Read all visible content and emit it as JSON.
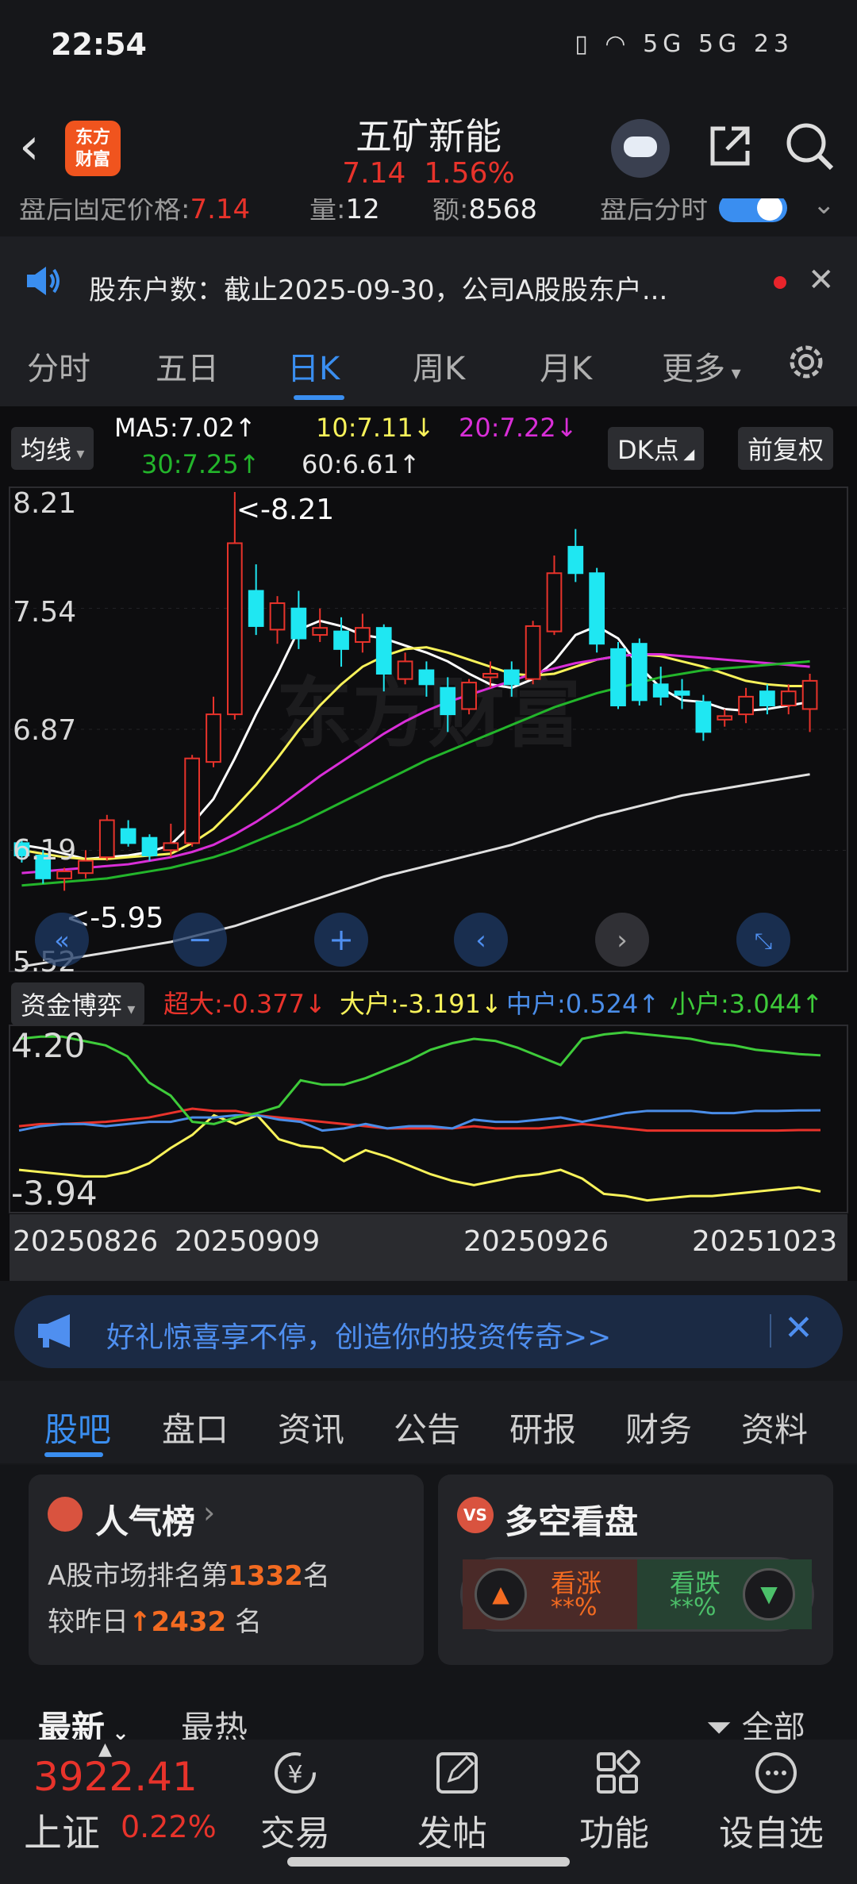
{
  "status": {
    "time": "22:54",
    "icons_text": "5G 5G 23"
  },
  "header": {
    "logo_text": "东方\n财富",
    "stock_name": "五矿新能",
    "price": "7.14",
    "change_pct": "1.56%"
  },
  "afterhours": {
    "fixed_label": "盘后固定价格:",
    "fixed_value": "7.14",
    "vol_label": "量:",
    "vol_value": "12",
    "amt_label": "额:",
    "amt_value": "8568",
    "timeshare_label": "盘后分时"
  },
  "notice": {
    "text": "股东户数：截止2025-09-30，公司A股股东户..."
  },
  "period_tabs": [
    "分时",
    "五日",
    "日K",
    "周K",
    "月K",
    "更多"
  ],
  "ma": {
    "selector": "均线",
    "ma5": "MA5:7.02↑",
    "ma10": "10:7.11↓",
    "ma20": "20:7.22↓",
    "ma30": "30:7.25↑",
    "ma60": "60:6.61↑",
    "dk": "DK点",
    "adjust": "前复权"
  },
  "colors": {
    "up": "#e8332b",
    "down": "#1fe7f2",
    "ma5": "#ffffff",
    "ma10": "#f8f25a",
    "ma20": "#d92ed8",
    "ma30": "#23b52b",
    "ma60": "#e0e0e0",
    "accent": "#3a8ef0"
  },
  "chart_data": [
    {
      "type": "candlestick",
      "y_ticks": [
        "8.21",
        "7.54",
        "6.87",
        "6.19",
        "5.52"
      ],
      "ylim": [
        5.52,
        8.21
      ],
      "annotations": {
        "high": "<-8.21",
        "low": "<-5.95"
      },
      "candles": [
        {
          "o": 6.22,
          "c": 6.15,
          "h": 6.24,
          "l": 6.11
        },
        {
          "o": 6.15,
          "c": 6.02,
          "h": 6.18,
          "l": 5.99
        },
        {
          "o": 6.02,
          "c": 6.06,
          "h": 6.08,
          "l": 5.95
        },
        {
          "o": 6.05,
          "c": 6.12,
          "h": 6.18,
          "l": 6.02
        },
        {
          "o": 6.14,
          "c": 6.35,
          "h": 6.38,
          "l": 6.12
        },
        {
          "o": 6.3,
          "c": 6.22,
          "h": 6.35,
          "l": 6.2
        },
        {
          "o": 6.25,
          "c": 6.15,
          "h": 6.27,
          "l": 6.12
        },
        {
          "o": 6.18,
          "c": 6.22,
          "h": 6.33,
          "l": 6.14
        },
        {
          "o": 6.22,
          "c": 6.7,
          "h": 6.72,
          "l": 6.2
        },
        {
          "o": 6.68,
          "c": 6.95,
          "h": 7.05,
          "l": 6.65
        },
        {
          "o": 6.95,
          "c": 7.92,
          "h": 8.21,
          "l": 6.92
        },
        {
          "o": 7.65,
          "c": 7.45,
          "h": 7.8,
          "l": 7.4
        },
        {
          "o": 7.43,
          "c": 7.58,
          "h": 7.62,
          "l": 7.35
        },
        {
          "o": 7.55,
          "c": 7.38,
          "h": 7.65,
          "l": 7.32
        },
        {
          "o": 7.4,
          "c": 7.44,
          "h": 7.55,
          "l": 7.36
        },
        {
          "o": 7.42,
          "c": 7.32,
          "h": 7.5,
          "l": 7.22
        },
        {
          "o": 7.36,
          "c": 7.44,
          "h": 7.52,
          "l": 7.3
        },
        {
          "o": 7.44,
          "c": 7.18,
          "h": 7.46,
          "l": 7.08
        },
        {
          "o": 7.15,
          "c": 7.25,
          "h": 7.3,
          "l": 7.12
        },
        {
          "o": 7.2,
          "c": 7.12,
          "h": 7.25,
          "l": 7.05
        },
        {
          "o": 7.1,
          "c": 6.95,
          "h": 7.16,
          "l": 6.85
        },
        {
          "o": 6.98,
          "c": 7.13,
          "h": 7.15,
          "l": 6.95
        },
        {
          "o": 7.16,
          "c": 7.18,
          "h": 7.25,
          "l": 7.1
        },
        {
          "o": 7.2,
          "c": 7.12,
          "h": 7.25,
          "l": 7.05
        },
        {
          "o": 7.15,
          "c": 7.45,
          "h": 7.48,
          "l": 7.12
        },
        {
          "o": 7.42,
          "c": 7.75,
          "h": 7.85,
          "l": 7.4
        },
        {
          "o": 7.9,
          "c": 7.75,
          "h": 8.0,
          "l": 7.7
        },
        {
          "o": 7.75,
          "c": 7.35,
          "h": 7.78,
          "l": 7.3
        },
        {
          "o": 7.32,
          "c": 7.0,
          "h": 7.36,
          "l": 6.98
        },
        {
          "o": 7.35,
          "c": 7.03,
          "h": 7.38,
          "l": 7.0
        },
        {
          "o": 7.12,
          "c": 7.05,
          "h": 7.22,
          "l": 7.0
        },
        {
          "o": 7.08,
          "c": 7.06,
          "h": 7.15,
          "l": 6.98
        },
        {
          "o": 7.02,
          "c": 6.85,
          "h": 7.06,
          "l": 6.8
        },
        {
          "o": 6.92,
          "c": 6.94,
          "h": 6.98,
          "l": 6.88
        },
        {
          "o": 6.95,
          "c": 7.05,
          "h": 7.1,
          "l": 6.9
        },
        {
          "o": 7.08,
          "c": 7.0,
          "h": 7.12,
          "l": 6.95
        },
        {
          "o": 7.0,
          "c": 7.08,
          "h": 7.12,
          "l": 6.95
        },
        {
          "o": 6.98,
          "c": 7.14,
          "h": 7.18,
          "l": 6.85
        }
      ],
      "ma_series": [
        {
          "name": "MA5",
          "values": [
            6.21,
            6.19,
            6.16,
            6.13,
            6.14,
            6.15,
            6.17,
            6.21,
            6.33,
            6.47,
            6.7,
            6.95,
            7.18,
            7.43,
            7.48,
            7.45,
            7.4,
            7.38,
            7.34,
            7.3,
            7.25,
            7.18,
            7.12,
            7.1,
            7.15,
            7.25,
            7.4,
            7.45,
            7.38,
            7.22,
            7.1,
            7.03,
            7.02,
            6.98,
            6.97,
            6.98,
            7.0,
            7.02
          ]
        },
        {
          "name": "10",
          "values": [
            6.18,
            6.16,
            6.14,
            6.13,
            6.13,
            6.14,
            6.15,
            6.16,
            6.22,
            6.3,
            6.42,
            6.55,
            6.7,
            6.86,
            7.0,
            7.12,
            7.22,
            7.28,
            7.32,
            7.33,
            7.3,
            7.26,
            7.22,
            7.18,
            7.17,
            7.18,
            7.22,
            7.26,
            7.28,
            7.29,
            7.28,
            7.25,
            7.22,
            7.18,
            7.14,
            7.12,
            7.11,
            7.11
          ]
        },
        {
          "name": "20",
          "values": [
            6.05,
            6.06,
            6.07,
            6.08,
            6.09,
            6.1,
            6.12,
            6.14,
            6.17,
            6.21,
            6.27,
            6.34,
            6.42,
            6.51,
            6.6,
            6.68,
            6.76,
            6.84,
            6.91,
            6.97,
            7.02,
            7.06,
            7.1,
            7.14,
            7.18,
            7.21,
            7.24,
            7.26,
            7.28,
            7.29,
            7.29,
            7.28,
            7.27,
            7.26,
            7.25,
            7.24,
            7.23,
            7.22
          ]
        },
        {
          "name": "30",
          "values": [
            5.98,
            5.99,
            6.0,
            6.01,
            6.02,
            6.04,
            6.06,
            6.08,
            6.11,
            6.14,
            6.18,
            6.23,
            6.28,
            6.33,
            6.39,
            6.45,
            6.51,
            6.57,
            6.63,
            6.69,
            6.74,
            6.79,
            6.84,
            6.89,
            6.94,
            6.99,
            7.03,
            7.07,
            7.1,
            7.13,
            7.16,
            7.18,
            7.2,
            7.21,
            7.22,
            7.23,
            7.24,
            7.25
          ]
        },
        {
          "name": "60",
          "values": [
            5.52,
            5.54,
            5.56,
            5.58,
            5.6,
            5.62,
            5.64,
            5.66,
            5.69,
            5.72,
            5.75,
            5.79,
            5.83,
            5.87,
            5.91,
            5.95,
            5.99,
            6.03,
            6.06,
            6.09,
            6.12,
            6.15,
            6.18,
            6.21,
            6.25,
            6.29,
            6.33,
            6.37,
            6.4,
            6.43,
            6.46,
            6.49,
            6.51,
            6.53,
            6.55,
            6.57,
            6.59,
            6.61
          ]
        }
      ]
    },
    {
      "type": "line",
      "title": "资金博弈",
      "y_ticks": [
        "4.20",
        "-3.94"
      ],
      "ylim": [
        -3.94,
        4.2
      ],
      "x_ticks": [
        "20250826",
        "20250909",
        "20250926",
        "20251023"
      ],
      "series": [
        {
          "name": "超大:-0.377↓",
          "color": "#e8332b",
          "values": [
            -0.2,
            -0.1,
            -0.1,
            -0.05,
            0.0,
            0.1,
            0.2,
            0.4,
            0.6,
            0.5,
            0.5,
            0.3,
            0.2,
            0.1,
            0.0,
            -0.1,
            -0.2,
            -0.3,
            -0.3,
            -0.3,
            -0.3,
            -0.2,
            -0.3,
            -0.3,
            -0.3,
            -0.2,
            -0.1,
            -0.2,
            -0.3,
            -0.4,
            -0.4,
            -0.4,
            -0.4,
            -0.4,
            -0.4,
            -0.4,
            -0.38,
            -0.377
          ]
        },
        {
          "name": "大户:-3.191↓",
          "color": "#f8f25a",
          "values": [
            -2.2,
            -2.3,
            -2.4,
            -2.5,
            -2.5,
            -2.3,
            -1.9,
            -1.2,
            -0.6,
            0.3,
            -0.1,
            0.3,
            -0.8,
            -1.1,
            -1.2,
            -1.8,
            -1.3,
            -1.6,
            -2.0,
            -2.4,
            -2.7,
            -2.9,
            -2.7,
            -2.5,
            -2.4,
            -2.2,
            -2.6,
            -3.3,
            -3.4,
            -3.6,
            -3.5,
            -3.4,
            -3.4,
            -3.3,
            -3.2,
            -3.1,
            -3.0,
            -3.191
          ]
        },
        {
          "name": "中户:0.524↑",
          "color": "#4a8de8",
          "values": [
            -0.4,
            -0.2,
            -0.1,
            -0.1,
            -0.2,
            -0.1,
            0.0,
            0.0,
            0.2,
            0.2,
            0.3,
            0.3,
            0.1,
            0.0,
            -0.4,
            -0.3,
            -0.1,
            -0.3,
            -0.2,
            -0.2,
            -0.3,
            0.1,
            0.0,
            0.0,
            0.1,
            0.2,
            0.0,
            0.2,
            0.4,
            0.5,
            0.5,
            0.5,
            0.4,
            0.4,
            0.5,
            0.5,
            0.52,
            0.524
          ]
        },
        {
          "name": "小户:3.044↑",
          "color": "#3ecb3a",
          "values": [
            3.8,
            3.9,
            3.9,
            3.7,
            3.5,
            3.0,
            1.8,
            1.2,
            0.0,
            -0.1,
            0.2,
            0.4,
            0.7,
            1.9,
            1.7,
            1.7,
            2.0,
            2.4,
            2.8,
            3.3,
            3.6,
            3.8,
            3.7,
            3.4,
            3.0,
            2.6,
            3.8,
            4.0,
            4.1,
            4.0,
            3.9,
            3.8,
            3.6,
            3.5,
            3.3,
            3.2,
            3.1,
            3.044
          ]
        }
      ]
    }
  ],
  "promo": {
    "text": "好礼惊喜享不停，创造你的投资传奇>>"
  },
  "section_tabs": [
    "股吧",
    "盘口",
    "资讯",
    "公告",
    "研报",
    "财务",
    "资料"
  ],
  "cards": {
    "popularity": {
      "title": "人气榜",
      "line1_prefix": "A股市场排名第",
      "rank": "1332",
      "line1_suffix": "名",
      "line2_prefix": "较昨日",
      "delta": "2432",
      "line2_suffix": "名"
    },
    "sentiment": {
      "badge": "VS",
      "title": "多空看盘",
      "up_label": "看涨",
      "up_pct": "**%",
      "down_label": "看跌",
      "down_pct": "**%"
    }
  },
  "feed": {
    "latest": "最新",
    "hot": "最热",
    "filter": "全部"
  },
  "bottom_nav": {
    "index_value": "3922.41",
    "index_name": "上证",
    "index_change": "0.22%",
    "items": [
      "交易",
      "发帖",
      "功能",
      "设自选"
    ]
  },
  "watermark": "东方财富"
}
